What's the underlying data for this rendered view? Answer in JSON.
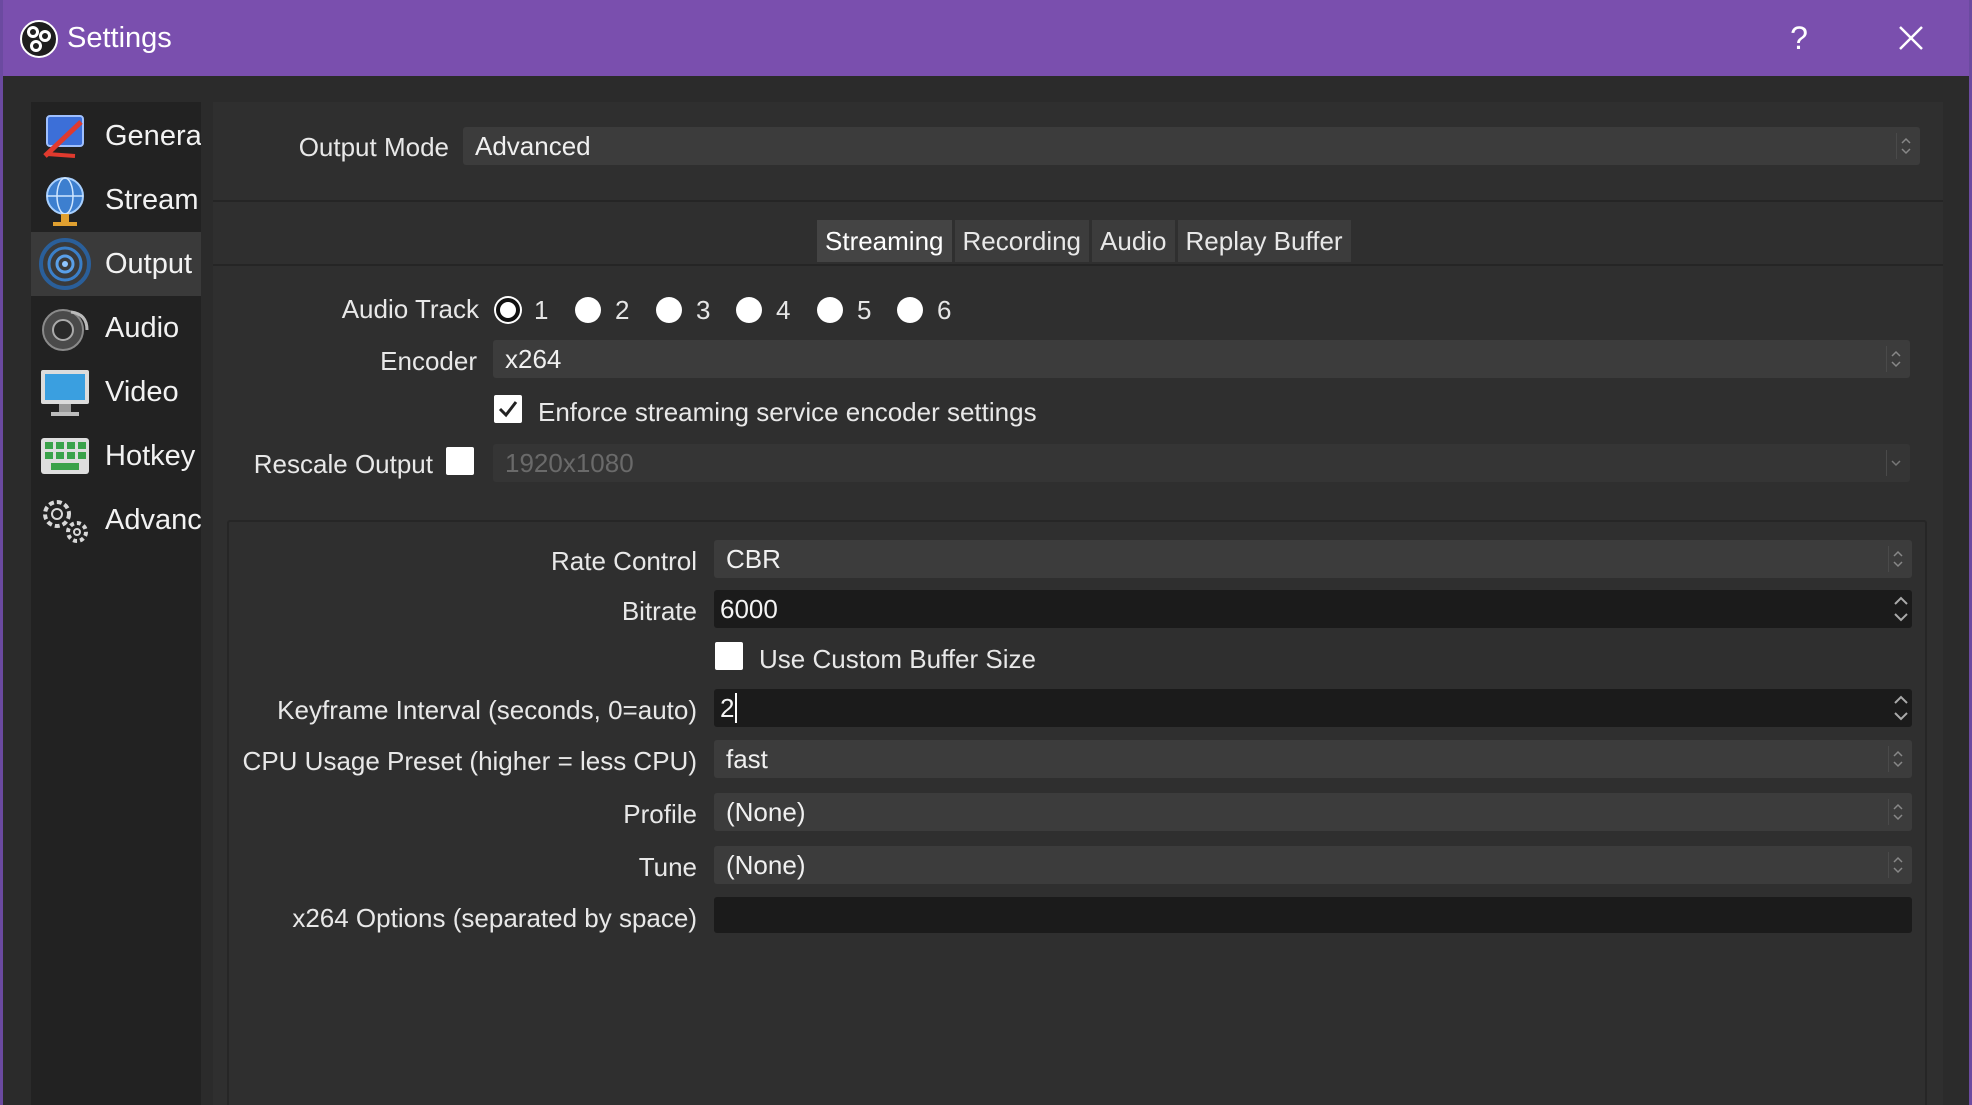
{
  "window": {
    "title": "Settings",
    "help_label": "?",
    "close_icon": "close-icon"
  },
  "colors": {
    "titlebar": "#7a4fae",
    "background": "#2f2f2f",
    "sidebar": "#222222",
    "field": "#3c3c3c",
    "spin_field": "#1b1b1b"
  },
  "sidebar": {
    "items": [
      {
        "label": "Genera",
        "icon": "general-icon"
      },
      {
        "label": "Stream",
        "icon": "stream-icon"
      },
      {
        "label": "Output",
        "icon": "output-icon",
        "active": true
      },
      {
        "label": "Audio",
        "icon": "audio-icon"
      },
      {
        "label": "Video",
        "icon": "video-icon"
      },
      {
        "label": "Hotkey",
        "icon": "hotkeys-icon"
      },
      {
        "label": "Advanc",
        "icon": "advanced-icon"
      }
    ]
  },
  "output_mode": {
    "label": "Output Mode",
    "value": "Advanced"
  },
  "tabs": [
    {
      "label": "Streaming",
      "active": true
    },
    {
      "label": "Recording"
    },
    {
      "label": "Audio"
    },
    {
      "label": "Replay Buffer"
    }
  ],
  "streaming": {
    "audio_track": {
      "label": "Audio Track",
      "options": [
        "1",
        "2",
        "3",
        "4",
        "5",
        "6"
      ],
      "selected": "1"
    },
    "encoder": {
      "label": "Encoder",
      "value": "x264"
    },
    "enforce": {
      "label": "Enforce streaming service encoder settings",
      "checked": true
    },
    "rescale": {
      "label": "Rescale Output",
      "checked": false,
      "value": "1920x1080"
    }
  },
  "encoder_settings": {
    "rate_control": {
      "label": "Rate Control",
      "value": "CBR"
    },
    "bitrate": {
      "label": "Bitrate",
      "value": "6000"
    },
    "custom_buffer": {
      "label": "Use Custom Buffer Size",
      "checked": false
    },
    "keyframe": {
      "label": "Keyframe Interval (seconds, 0=auto)",
      "value": "2"
    },
    "cpu_preset": {
      "label": "CPU Usage Preset (higher = less CPU)",
      "value": "fast"
    },
    "profile": {
      "label": "Profile",
      "value": "(None)"
    },
    "tune": {
      "label": "Tune",
      "value": "(None)"
    },
    "x264_options": {
      "label": "x264 Options (separated by space)",
      "value": ""
    }
  }
}
